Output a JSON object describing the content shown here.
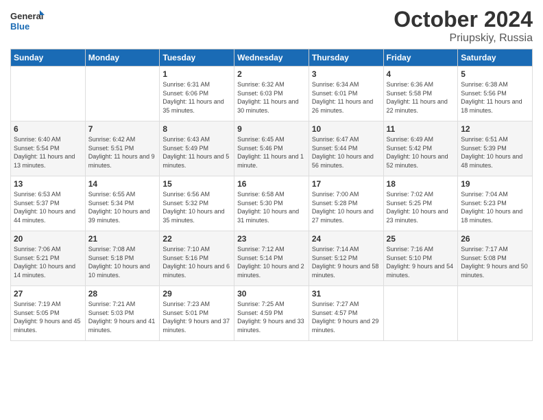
{
  "header": {
    "logo_general": "General",
    "logo_blue": "Blue",
    "month_title": "October 2024",
    "location": "Priupskiy, Russia"
  },
  "weekdays": [
    "Sunday",
    "Monday",
    "Tuesday",
    "Wednesday",
    "Thursday",
    "Friday",
    "Saturday"
  ],
  "weeks": [
    [
      {
        "day": "",
        "sunrise": "",
        "sunset": "",
        "daylight": ""
      },
      {
        "day": "",
        "sunrise": "",
        "sunset": "",
        "daylight": ""
      },
      {
        "day": "1",
        "sunrise": "Sunrise: 6:31 AM",
        "sunset": "Sunset: 6:06 PM",
        "daylight": "Daylight: 11 hours and 35 minutes."
      },
      {
        "day": "2",
        "sunrise": "Sunrise: 6:32 AM",
        "sunset": "Sunset: 6:03 PM",
        "daylight": "Daylight: 11 hours and 30 minutes."
      },
      {
        "day": "3",
        "sunrise": "Sunrise: 6:34 AM",
        "sunset": "Sunset: 6:01 PM",
        "daylight": "Daylight: 11 hours and 26 minutes."
      },
      {
        "day": "4",
        "sunrise": "Sunrise: 6:36 AM",
        "sunset": "Sunset: 5:58 PM",
        "daylight": "Daylight: 11 hours and 22 minutes."
      },
      {
        "day": "5",
        "sunrise": "Sunrise: 6:38 AM",
        "sunset": "Sunset: 5:56 PM",
        "daylight": "Daylight: 11 hours and 18 minutes."
      }
    ],
    [
      {
        "day": "6",
        "sunrise": "Sunrise: 6:40 AM",
        "sunset": "Sunset: 5:54 PM",
        "daylight": "Daylight: 11 hours and 13 minutes."
      },
      {
        "day": "7",
        "sunrise": "Sunrise: 6:42 AM",
        "sunset": "Sunset: 5:51 PM",
        "daylight": "Daylight: 11 hours and 9 minutes."
      },
      {
        "day": "8",
        "sunrise": "Sunrise: 6:43 AM",
        "sunset": "Sunset: 5:49 PM",
        "daylight": "Daylight: 11 hours and 5 minutes."
      },
      {
        "day": "9",
        "sunrise": "Sunrise: 6:45 AM",
        "sunset": "Sunset: 5:46 PM",
        "daylight": "Daylight: 11 hours and 1 minute."
      },
      {
        "day": "10",
        "sunrise": "Sunrise: 6:47 AM",
        "sunset": "Sunset: 5:44 PM",
        "daylight": "Daylight: 10 hours and 56 minutes."
      },
      {
        "day": "11",
        "sunrise": "Sunrise: 6:49 AM",
        "sunset": "Sunset: 5:42 PM",
        "daylight": "Daylight: 10 hours and 52 minutes."
      },
      {
        "day": "12",
        "sunrise": "Sunrise: 6:51 AM",
        "sunset": "Sunset: 5:39 PM",
        "daylight": "Daylight: 10 hours and 48 minutes."
      }
    ],
    [
      {
        "day": "13",
        "sunrise": "Sunrise: 6:53 AM",
        "sunset": "Sunset: 5:37 PM",
        "daylight": "Daylight: 10 hours and 44 minutes."
      },
      {
        "day": "14",
        "sunrise": "Sunrise: 6:55 AM",
        "sunset": "Sunset: 5:34 PM",
        "daylight": "Daylight: 10 hours and 39 minutes."
      },
      {
        "day": "15",
        "sunrise": "Sunrise: 6:56 AM",
        "sunset": "Sunset: 5:32 PM",
        "daylight": "Daylight: 10 hours and 35 minutes."
      },
      {
        "day": "16",
        "sunrise": "Sunrise: 6:58 AM",
        "sunset": "Sunset: 5:30 PM",
        "daylight": "Daylight: 10 hours and 31 minutes."
      },
      {
        "day": "17",
        "sunrise": "Sunrise: 7:00 AM",
        "sunset": "Sunset: 5:28 PM",
        "daylight": "Daylight: 10 hours and 27 minutes."
      },
      {
        "day": "18",
        "sunrise": "Sunrise: 7:02 AM",
        "sunset": "Sunset: 5:25 PM",
        "daylight": "Daylight: 10 hours and 23 minutes."
      },
      {
        "day": "19",
        "sunrise": "Sunrise: 7:04 AM",
        "sunset": "Sunset: 5:23 PM",
        "daylight": "Daylight: 10 hours and 18 minutes."
      }
    ],
    [
      {
        "day": "20",
        "sunrise": "Sunrise: 7:06 AM",
        "sunset": "Sunset: 5:21 PM",
        "daylight": "Daylight: 10 hours and 14 minutes."
      },
      {
        "day": "21",
        "sunrise": "Sunrise: 7:08 AM",
        "sunset": "Sunset: 5:18 PM",
        "daylight": "Daylight: 10 hours and 10 minutes."
      },
      {
        "day": "22",
        "sunrise": "Sunrise: 7:10 AM",
        "sunset": "Sunset: 5:16 PM",
        "daylight": "Daylight: 10 hours and 6 minutes."
      },
      {
        "day": "23",
        "sunrise": "Sunrise: 7:12 AM",
        "sunset": "Sunset: 5:14 PM",
        "daylight": "Daylight: 10 hours and 2 minutes."
      },
      {
        "day": "24",
        "sunrise": "Sunrise: 7:14 AM",
        "sunset": "Sunset: 5:12 PM",
        "daylight": "Daylight: 9 hours and 58 minutes."
      },
      {
        "day": "25",
        "sunrise": "Sunrise: 7:16 AM",
        "sunset": "Sunset: 5:10 PM",
        "daylight": "Daylight: 9 hours and 54 minutes."
      },
      {
        "day": "26",
        "sunrise": "Sunrise: 7:17 AM",
        "sunset": "Sunset: 5:08 PM",
        "daylight": "Daylight: 9 hours and 50 minutes."
      }
    ],
    [
      {
        "day": "27",
        "sunrise": "Sunrise: 7:19 AM",
        "sunset": "Sunset: 5:05 PM",
        "daylight": "Daylight: 9 hours and 45 minutes."
      },
      {
        "day": "28",
        "sunrise": "Sunrise: 7:21 AM",
        "sunset": "Sunset: 5:03 PM",
        "daylight": "Daylight: 9 hours and 41 minutes."
      },
      {
        "day": "29",
        "sunrise": "Sunrise: 7:23 AM",
        "sunset": "Sunset: 5:01 PM",
        "daylight": "Daylight: 9 hours and 37 minutes."
      },
      {
        "day": "30",
        "sunrise": "Sunrise: 7:25 AM",
        "sunset": "Sunset: 4:59 PM",
        "daylight": "Daylight: 9 hours and 33 minutes."
      },
      {
        "day": "31",
        "sunrise": "Sunrise: 7:27 AM",
        "sunset": "Sunset: 4:57 PM",
        "daylight": "Daylight: 9 hours and 29 minutes."
      },
      {
        "day": "",
        "sunrise": "",
        "sunset": "",
        "daylight": ""
      },
      {
        "day": "",
        "sunrise": "",
        "sunset": "",
        "daylight": ""
      }
    ]
  ]
}
